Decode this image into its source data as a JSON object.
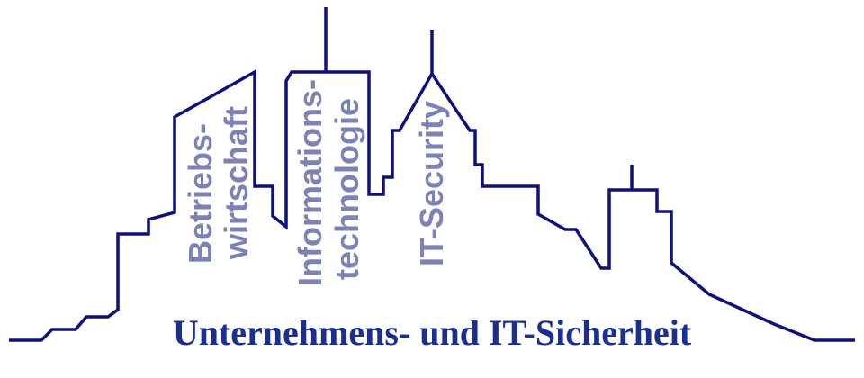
{
  "colors": {
    "skyline_line": "#0e117a",
    "label_text": "#7d82b4",
    "title_text": "#1a2f8f",
    "background": "#ffffff"
  },
  "labels": {
    "betriebswirtschaft": [
      "Betriebs-",
      "wirtschaft"
    ],
    "informationstechnologie": [
      "Informations-",
      "technologie"
    ],
    "it_security": "IT-Security"
  },
  "title": "Unternehmens- und IT-Sicherheit"
}
